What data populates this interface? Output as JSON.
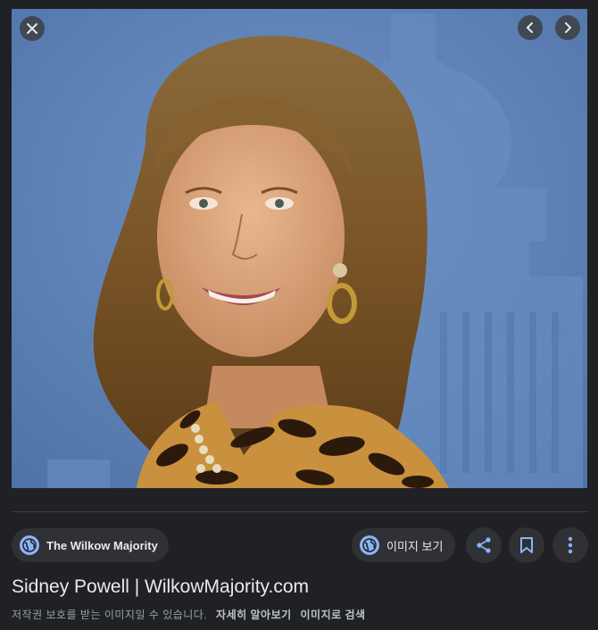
{
  "viewer": {
    "close_icon": "close-icon",
    "prev_icon": "chevron-left-icon",
    "next_icon": "chevron-right-icon",
    "image_subject": "photo-subject"
  },
  "source": {
    "icon": "globe-icon",
    "site_name": "The Wilkow Majority"
  },
  "actions": {
    "view_image_label": "이미지 보기",
    "view_image_icon": "globe-icon",
    "share_icon": "share-icon",
    "save_icon": "bookmark-icon",
    "more_icon": "more-vert-icon"
  },
  "title": "Sidney Powell | WilkowMajority.com",
  "caption": {
    "notice": "저작권 보호를 받는 이미지일 수 있습니다.",
    "learn_more": "자세히 알아보기",
    "search_by_image": "이미지로 검색"
  },
  "colors": {
    "background": "#202124",
    "chip": "#303134",
    "accent": "#8ab4f8",
    "photo_backdrop": "#5b7fb4"
  }
}
